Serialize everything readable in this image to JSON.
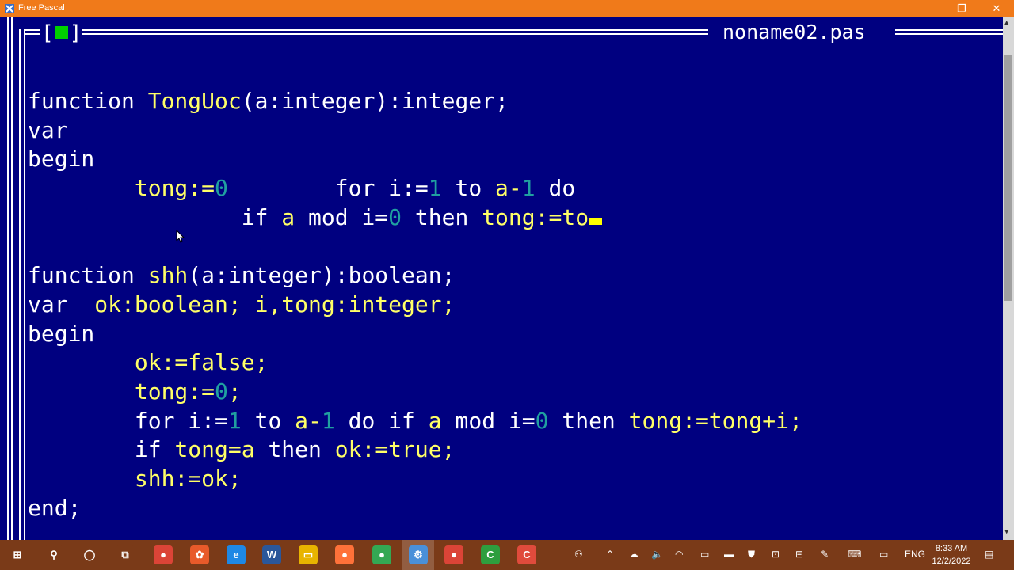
{
  "window": {
    "title": "Free Pascal",
    "minimize": "—",
    "maximize": "❐",
    "close": "✕"
  },
  "editor": {
    "close_box_left": "[",
    "close_box_right": "]",
    "file_title": "noname02.pas"
  },
  "code_lines": [
    [
      {
        "t": "function ",
        "c": "kw"
      },
      {
        "t": "TongUoc",
        "c": "id"
      },
      {
        "t": "(a:integer):integer;",
        "c": "kw"
      }
    ],
    [
      {
        "t": "var",
        "c": "kw"
      }
    ],
    [
      {
        "t": "begin",
        "c": "kw"
      }
    ],
    [
      {
        "t": "        ",
        "c": "kw"
      },
      {
        "t": "tong:=",
        "c": "id"
      },
      {
        "t": "0",
        "c": "num"
      },
      {
        "t": "        for i:=",
        "c": "kw"
      },
      {
        "t": "1",
        "c": "num"
      },
      {
        "t": " to ",
        "c": "kw"
      },
      {
        "t": "a-",
        "c": "id"
      },
      {
        "t": "1",
        "c": "num"
      },
      {
        "t": " do",
        "c": "kw"
      }
    ],
    [
      {
        "t": "                if ",
        "c": "kw"
      },
      {
        "t": "a",
        "c": "id"
      },
      {
        "t": " mod i=",
        "c": "kw"
      },
      {
        "t": "0",
        "c": "num"
      },
      {
        "t": " then ",
        "c": "kw"
      },
      {
        "t": "tong:=to",
        "c": "id"
      },
      {
        "t": "",
        "c": "cursor"
      }
    ],
    [],
    [
      {
        "t": "function ",
        "c": "kw"
      },
      {
        "t": "shh",
        "c": "id"
      },
      {
        "t": "(a:integer):boolean;",
        "c": "kw"
      }
    ],
    [
      {
        "t": "var  ",
        "c": "kw"
      },
      {
        "t": "ok:boolean; i,tong:integer;",
        "c": "id"
      }
    ],
    [
      {
        "t": "begin",
        "c": "kw"
      }
    ],
    [
      {
        "t": "        ",
        "c": "kw"
      },
      {
        "t": "ok:=false;",
        "c": "id"
      }
    ],
    [
      {
        "t": "        ",
        "c": "kw"
      },
      {
        "t": "tong:=",
        "c": "id"
      },
      {
        "t": "0",
        "c": "num"
      },
      {
        "t": ";",
        "c": "id"
      }
    ],
    [
      {
        "t": "        for i:=",
        "c": "kw"
      },
      {
        "t": "1",
        "c": "num"
      },
      {
        "t": " to ",
        "c": "kw"
      },
      {
        "t": "a-",
        "c": "id"
      },
      {
        "t": "1",
        "c": "num"
      },
      {
        "t": " do if ",
        "c": "kw"
      },
      {
        "t": "a",
        "c": "id"
      },
      {
        "t": " mod i=",
        "c": "kw"
      },
      {
        "t": "0",
        "c": "num"
      },
      {
        "t": " then ",
        "c": "kw"
      },
      {
        "t": "tong:=tong+i;",
        "c": "id"
      }
    ],
    [
      {
        "t": "        if ",
        "c": "kw"
      },
      {
        "t": "tong=a",
        "c": "id"
      },
      {
        "t": " then ",
        "c": "kw"
      },
      {
        "t": "ok:=true;",
        "c": "id"
      }
    ],
    [
      {
        "t": "        ",
        "c": "kw"
      },
      {
        "t": "shh:=ok;",
        "c": "id"
      }
    ],
    [
      {
        "t": "end;",
        "c": "kw"
      }
    ]
  ],
  "taskbar": {
    "apps": [
      {
        "name": "start-button",
        "glyph": "⊞",
        "color": "#7a3a18"
      },
      {
        "name": "search-icon",
        "glyph": "⚲",
        "color": "#7a3a18"
      },
      {
        "name": "cortana-icon",
        "glyph": "◯",
        "color": "#7a3a18"
      },
      {
        "name": "task-view-icon",
        "glyph": "⧉",
        "color": "#7a3a18"
      },
      {
        "name": "chrome-icon",
        "glyph": "●",
        "color": "#db4437"
      },
      {
        "name": "app-icon",
        "glyph": "✿",
        "color": "#e85a2a"
      },
      {
        "name": "edge-icon",
        "glyph": "e",
        "color": "#1e88e5"
      },
      {
        "name": "word-icon",
        "glyph": "W",
        "color": "#2b579a"
      },
      {
        "name": "file-explorer-icon",
        "glyph": "▭",
        "color": "#e8b400"
      },
      {
        "name": "firefox-icon",
        "glyph": "●",
        "color": "#ff7139"
      },
      {
        "name": "chrome-user-icon",
        "glyph": "●",
        "color": "#34a853"
      },
      {
        "name": "free-pascal-icon",
        "glyph": "⚙",
        "color": "#4a90d9"
      },
      {
        "name": "chrome-2-icon",
        "glyph": "●",
        "color": "#db4437"
      },
      {
        "name": "codeblocks-icon",
        "glyph": "C",
        "color": "#2e9e3e"
      },
      {
        "name": "camtasia-icon",
        "glyph": "C",
        "color": "#e04b3c"
      }
    ],
    "tray": {
      "language": "ENG",
      "time": "8:33 AM",
      "date": "12/2/2022"
    }
  }
}
